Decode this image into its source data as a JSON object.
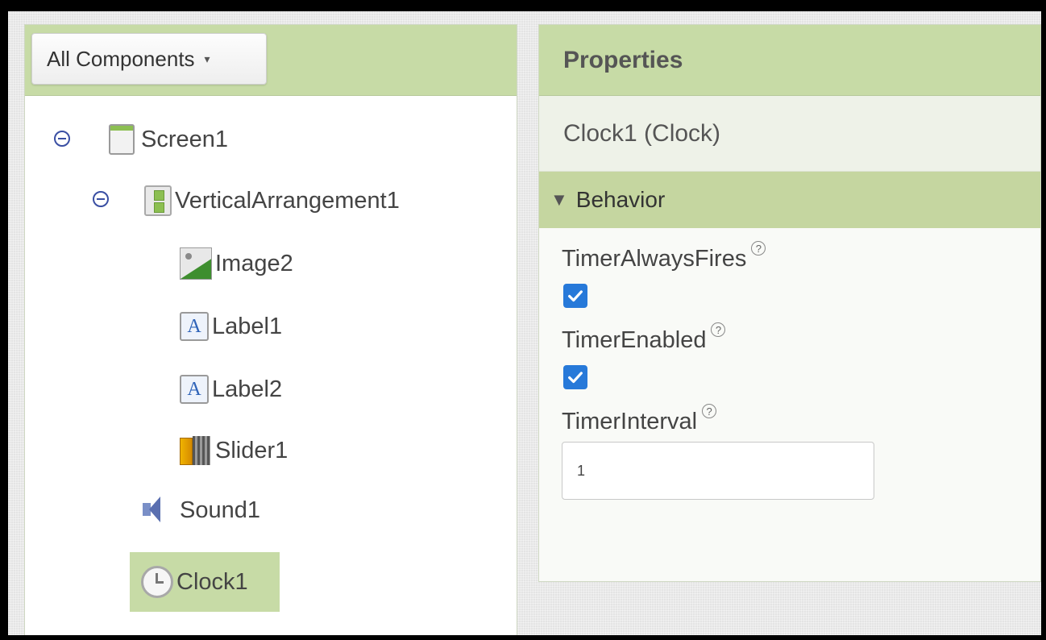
{
  "components_panel": {
    "dropdown_label": "All Components",
    "dropdown_caret": "▾",
    "tree": [
      {
        "label": "Screen1",
        "icon": "screen-icon",
        "expanded": true
      },
      {
        "label": "VerticalArrangement1",
        "icon": "vertical-arrangement-icon",
        "expanded": true
      },
      {
        "label": "Image2",
        "icon": "image-icon"
      },
      {
        "label": "Label1",
        "icon": "label-icon",
        "icon_text": "A"
      },
      {
        "label": "Label2",
        "icon": "label-icon",
        "icon_text": "A"
      },
      {
        "label": "Slider1",
        "icon": "slider-icon"
      },
      {
        "label": "Sound1",
        "icon": "sound-icon"
      },
      {
        "label": "Clock1",
        "icon": "clock-icon",
        "selected": true
      }
    ]
  },
  "properties_panel": {
    "title": "Properties",
    "component_title": "Clock1 (Clock)",
    "section_label": "Behavior",
    "section_icon": "▼",
    "help_glyph": "?",
    "properties": [
      {
        "name": "TimerAlwaysFires",
        "type": "checkbox",
        "checked": true
      },
      {
        "name": "TimerEnabled",
        "type": "checkbox",
        "checked": true
      },
      {
        "name": "TimerInterval",
        "type": "text",
        "value": "1"
      }
    ]
  },
  "colors": {
    "header_green": "#c7dba6",
    "section_green": "#c5d6a0",
    "checkbox_blue": "#2779d9",
    "tree_toggle_blue": "#3a4fa3"
  }
}
